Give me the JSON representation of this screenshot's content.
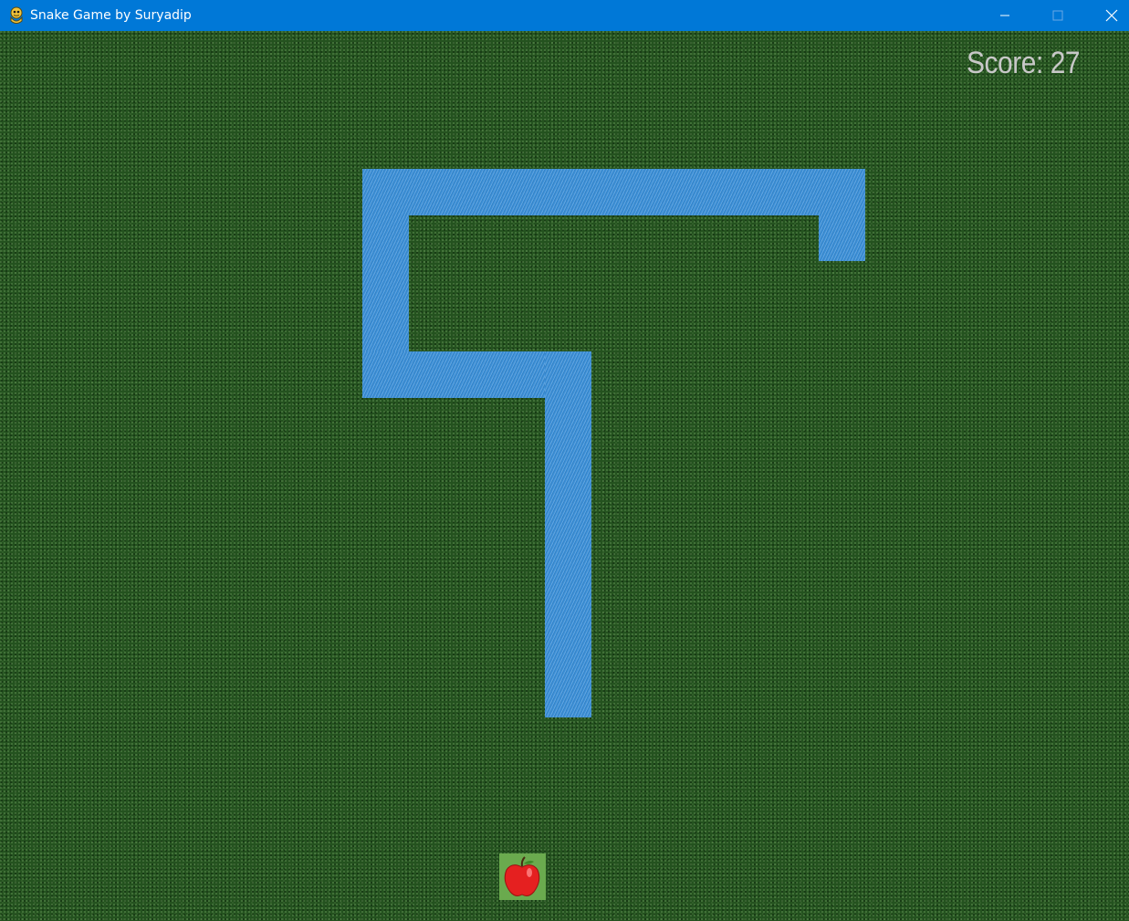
{
  "window": {
    "title": "Snake Game by Suryadip",
    "app_icon": "python-icon",
    "controls": [
      "minimize-icon",
      "maximize-icon",
      "close-icon"
    ]
  },
  "hud": {
    "score_text": "Score: 27"
  },
  "colors": {
    "titlebar": "#0078d7",
    "background": "#24521f",
    "snake": "#3a8fd8",
    "score_text": "#c8c8c8",
    "apple": "#e52020",
    "apple_tile": "#6aaa4e"
  },
  "food": {
    "type": "apple-icon"
  }
}
